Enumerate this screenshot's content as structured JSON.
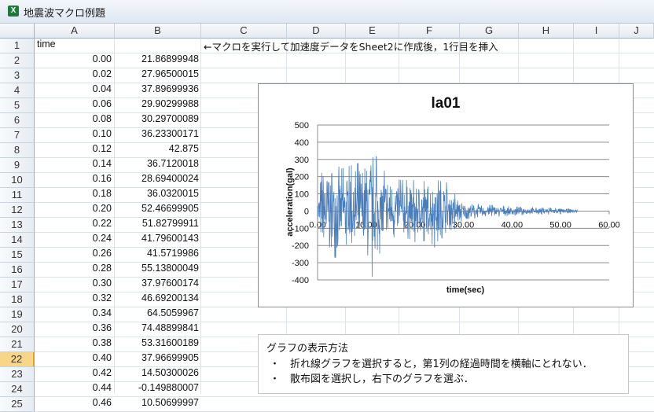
{
  "window": {
    "title": "地震波マクロ例題",
    "app_icon": "excel-icon"
  },
  "columns": [
    "A",
    "B",
    "C",
    "D",
    "E",
    "F",
    "G",
    "H",
    "I",
    "J"
  ],
  "selected_row": "22",
  "rows": [
    {
      "num": "1",
      "a": "time",
      "b": ""
    },
    {
      "num": "2",
      "a": "0.00",
      "b": "21.86899948"
    },
    {
      "num": "3",
      "a": "0.02",
      "b": "27.96500015"
    },
    {
      "num": "4",
      "a": "0.04",
      "b": "37.89699936"
    },
    {
      "num": "5",
      "a": "0.06",
      "b": "29.90299988"
    },
    {
      "num": "6",
      "a": "0.08",
      "b": "30.29700089"
    },
    {
      "num": "7",
      "a": "0.10",
      "b": "36.23300171"
    },
    {
      "num": "8",
      "a": "0.12",
      "b": "42.875"
    },
    {
      "num": "9",
      "a": "0.14",
      "b": "36.7120018"
    },
    {
      "num": "10",
      "a": "0.16",
      "b": "28.69400024"
    },
    {
      "num": "11",
      "a": "0.18",
      "b": "36.0320015"
    },
    {
      "num": "12",
      "a": "0.20",
      "b": "52.46699905"
    },
    {
      "num": "13",
      "a": "0.22",
      "b": "51.82799911"
    },
    {
      "num": "14",
      "a": "0.24",
      "b": "41.79600143"
    },
    {
      "num": "15",
      "a": "0.26",
      "b": "41.5719986"
    },
    {
      "num": "16",
      "a": "0.28",
      "b": "55.13800049"
    },
    {
      "num": "17",
      "a": "0.30",
      "b": "37.97600174"
    },
    {
      "num": "18",
      "a": "0.32",
      "b": "46.69200134"
    },
    {
      "num": "19",
      "a": "0.34",
      "b": "64.5059967"
    },
    {
      "num": "20",
      "a": "0.36",
      "b": "74.48899841"
    },
    {
      "num": "21",
      "a": "0.38",
      "b": "53.31600189"
    },
    {
      "num": "22",
      "a": "0.40",
      "b": "37.96699905"
    },
    {
      "num": "23",
      "a": "0.42",
      "b": "14.50300026"
    },
    {
      "num": "24",
      "a": "0.44",
      "b": "-0.149880007"
    },
    {
      "num": "25",
      "a": "0.46",
      "b": "10.50699997"
    }
  ],
  "c1_note": "←マクロを実行して加速度データをSheet2に作成後，1行目を挿入",
  "note": {
    "heading": "グラフの表示方法",
    "lines": [
      "・　折れ線グラフを選択すると，第1列の経過時間を横軸にとれない．",
      "・　散布図を選択し，右下のグラフを選ぶ．"
    ]
  },
  "chart_data": {
    "type": "line",
    "title": "la01",
    "xlabel": "time(sec)",
    "ylabel": "acceleration(gal)",
    "xlim": [
      0,
      60
    ],
    "ylim": [
      -400,
      500
    ],
    "x_ticks": [
      "0.00",
      "10.00",
      "20.00",
      "30.00",
      "40.00",
      "50.00",
      "60.00"
    ],
    "y_ticks": [
      "500",
      "400",
      "300",
      "200",
      "100",
      "0",
      "-100",
      "-200",
      "-300",
      "-400"
    ],
    "grid": true,
    "legend": "none",
    "series_color": "#4a7ebb",
    "envelope": [
      {
        "t": 0,
        "amp": 60
      },
      {
        "t": 1,
        "amp": 330
      },
      {
        "t": 3,
        "amp": 300
      },
      {
        "t": 5,
        "amp": 260
      },
      {
        "t": 9,
        "amp": 300
      },
      {
        "t": 11,
        "amp": 420
      },
      {
        "t": 13,
        "amp": 260
      },
      {
        "t": 17,
        "amp": 190
      },
      {
        "t": 20,
        "amp": 190
      },
      {
        "t": 23,
        "amp": 180
      },
      {
        "t": 25,
        "amp": 260
      },
      {
        "t": 27,
        "amp": 150
      },
      {
        "t": 30,
        "amp": 50
      },
      {
        "t": 40,
        "amp": 28
      },
      {
        "t": 50,
        "amp": 18
      },
      {
        "t": 53.5,
        "amp": 10
      }
    ]
  }
}
